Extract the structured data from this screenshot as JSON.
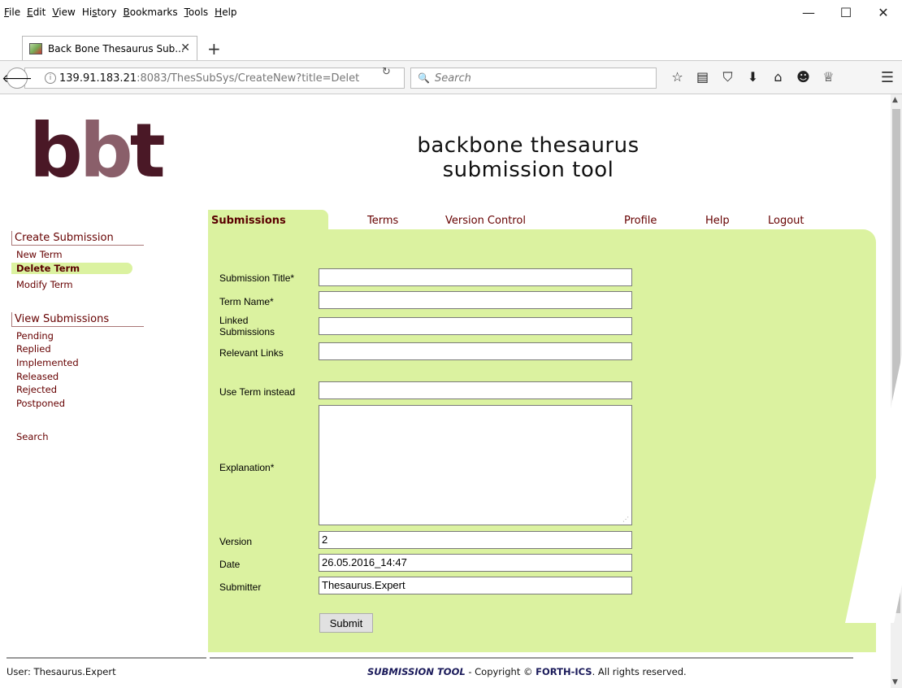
{
  "menubar": {
    "items": [
      {
        "prefix": "",
        "u": "F",
        "rest": "ile"
      },
      {
        "prefix": "",
        "u": "E",
        "rest": "dit"
      },
      {
        "prefix": "",
        "u": "V",
        "rest": "iew"
      },
      {
        "prefix": "Hi",
        "u": "s",
        "rest": "tory"
      },
      {
        "prefix": "",
        "u": "B",
        "rest": "ookmarks"
      },
      {
        "prefix": "",
        "u": "T",
        "rest": "ools"
      },
      {
        "prefix": "",
        "u": "H",
        "rest": "elp"
      }
    ],
    "window_controls": [
      "—",
      "☐",
      "✕"
    ]
  },
  "browser": {
    "tab_title": "Back Bone Thesaurus Sub...",
    "tab_close": "✕",
    "new_tab": "+",
    "url_host": "139.91.183.21",
    "url_rest": ":8083/ThesSubSys/CreateNew?title=Delet",
    "search_placeholder": "Search",
    "icons": [
      "star-icon",
      "reading-list-icon",
      "pocket-icon",
      "download-icon",
      "home-icon",
      "chat-icon",
      "trophy-icon"
    ]
  },
  "site": {
    "logo_b1": "b",
    "logo_b2": "b",
    "logo_t": "t",
    "title_line1": "backbone thesaurus",
    "title_line2": "submission tool"
  },
  "nav": {
    "tabs": [
      "Submissions",
      "Terms",
      "Version Control",
      "Profile",
      "Help",
      "Logout"
    ]
  },
  "sidebar": {
    "create_header": "Create Submission",
    "create_items": [
      "New Term",
      "Delete Term",
      "Modify Term"
    ],
    "view_header": "View Submissions",
    "view_items": [
      "Pending",
      "Replied",
      "Implemented",
      "Released",
      "Rejected",
      "Postponed"
    ],
    "search": "Search"
  },
  "form": {
    "submission_title_label": "Submission Title*",
    "submission_title_value": "",
    "term_name_label": "Term Name*",
    "term_name_value": "",
    "linked_label_1": "Linked",
    "linked_label_2": "Submissions",
    "linked_value": "",
    "relevant_links_label": "Relevant Links",
    "relevant_links_value": "",
    "use_term_label": "Use Term instead",
    "use_term_value": "",
    "explanation_label": "Explanation*",
    "version_label": "Version",
    "version_value": "2",
    "date_label": "Date",
    "date_value": "26.05.2016_14:47",
    "submitter_label": "Submitter",
    "submitter_value": "Thesaurus.Expert",
    "submit_label": "Submit"
  },
  "footer": {
    "user": "User: Thesaurus.Expert",
    "brand": "SUBMISSION TOOL",
    "copy_mid": " - Copyright © ",
    "forth": "FORTH-ICS",
    "copy_end": ". All rights reserved."
  }
}
